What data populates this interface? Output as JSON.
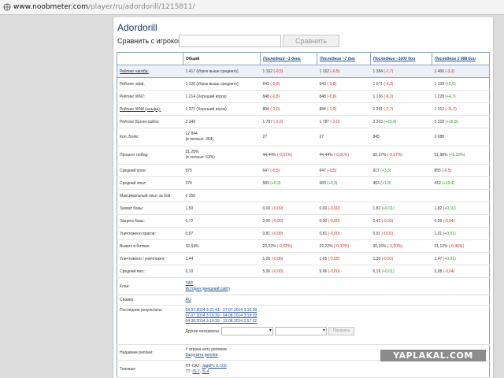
{
  "browser": {
    "url_domain": "www.noobmeter.com",
    "url_path": "/player/ru/adordorill/1215811/"
  },
  "player": {
    "name": "Adordorill"
  },
  "compare": {
    "label": "Сравнить с игроком",
    "input_value": "",
    "button": "Сравнить"
  },
  "table": {
    "columns": [
      "Общий",
      "Последний ~1 день",
      "Последние ~7 дни",
      "Последние ~1000 бои",
      "Последние 3 088 бои"
    ],
    "rows": [
      {
        "label": "Рейтинг нагиба:",
        "values": [
          "1 417 (Игрок выше среднего)",
          "1 162 (-0,5)",
          "1 162 (-0,5)",
          "1 384 (-2,7)",
          "1 406 (-3,2)"
        ]
      },
      {
        "label": "Рейтинг эфф.",
        "values": [
          "1 126 (Игрок выше среднего)",
          "643 (-0,8)",
          "643 (-0,8)",
          "1 071 (-4,3)",
          "1 139 (+5,0)"
        ]
      },
      {
        "label": "Рейтинг WN7:",
        "values": [
          "1 214 (Хороший игрок)",
          "848 (-0,8)",
          "848 (-0,8)",
          "1 136 (-8,2)",
          "1 228 (+4,7)"
        ]
      },
      {
        "label": "Рейтинг WN8 (альфа):",
        "values": [
          "1 372 (Хороший игрок)",
          "884 (-1,0)",
          "884 (-1,0)",
          "1 291 (-2,7)",
          "1 312 (-11,2)"
        ]
      },
      {
        "label": "Рейтинг Броне-сайта:",
        "values": [
          "3 249",
          "1 787 (-3,0)",
          "1 787 (-3,0)",
          "3 203 (+23,4)",
          "3 318 (+16,8)"
        ]
      },
      {
        "label": "Кол. Боёв:",
        "values": [
          "12 844",
          "27",
          "27",
          "845",
          "3 088"
        ],
        "subs": [
          "(в полных: 364)",
          "",
          "",
          "",
          ""
        ]
      },
      {
        "label": "Процент побед:",
        "values": [
          "51,28%",
          "44,44% (-0,01%)",
          "44,44% (-0,01%)",
          "50,37% (-0,07%)",
          "51,98% (+0,22%)"
        ],
        "subs": [
          "(в полных: 53%)",
          "",
          "",
          "",
          ""
        ]
      },
      {
        "label": "Средний урон:",
        "values": [
          "875",
          "647 (-0,5)",
          "647 (-0,5)",
          "917 (+3,3)",
          "855 (-6,5)"
        ]
      },
      {
        "label": "Средний опыт:",
        "values": [
          "379",
          "583 (+0,3)",
          "583 (+0,3)",
          "403 (+1,9)",
          "412 (+10,4)"
        ]
      },
      {
        "label": "Максимальный опыт за бой:",
        "values": [
          "2 256",
          "",
          "",
          "",
          ""
        ]
      },
      {
        "label": "Захват базы:",
        "values": [
          "1,50",
          "0,00 (-0,00)",
          "0,00 (-0,00)",
          "1,82 (+0,01)",
          "1,82 (+0,10)"
        ]
      },
      {
        "label": "Защита базы:",
        "values": [
          "0,72",
          "0,00 (-0,00)",
          "0,00 (-0,00)",
          "0,42 (-0,02)",
          "0,59 (-0,04)"
        ]
      },
      {
        "label": "Уничтожено врагов:",
        "values": [
          "0,97",
          "0,81 (-0,00)",
          "0,81 (-0,00)",
          "0,91 (-0,01)",
          "1,01 (+0,01)"
        ]
      },
      {
        "label": "Выжил в битвах:",
        "values": [
          "32,64%",
          "22,22% (-0,02%)",
          "22,22% (-0,02%)",
          "30,16% (-0,20%)",
          "31,12% (-0,46%)"
        ]
      },
      {
        "label": "Уничтожено / уничтожен:",
        "values": [
          "1,44",
          "1,05 (-0,00)",
          "1,05 (-0,00)",
          "1,30 (-0,01)",
          "1,47 (+0,01)"
        ]
      },
      {
        "label": "Средний пвл.:",
        "values": [
          "6,10",
          "5,96 (-0,00)",
          "5,96 (-0,00)",
          "6,19 (+0,01)",
          "5,98 (-0,04)"
        ]
      }
    ],
    "clan": {
      "label": "Клан:",
      "tag": "YAP",
      "history": "История (внешний сайт)"
    },
    "server": {
      "label": "Сервер:",
      "value": "RU"
    },
    "results": {
      "label": "Последние результаты:",
      "ranges": [
        "04.07.2014 3:21:41 - 07.07.2014 3:16:39",
        "07.07.2014 3:16:39 - 04.08.2014 3:19:39",
        "04.08.2014 3:19:39 - 12.08.2014 2:57:32"
      ],
      "other_label": "Другие интервалы:",
      "show_button": "Показать"
    },
    "replays": {
      "label": "Недавние реплеи:",
      "none_text": "У игрока нету реплеев",
      "upload_link": "Загрузить реплеи"
    },
    "tops": {
      "label": "Топовые",
      "line1_prefix": "ПТ-САУ:",
      "line1_link": "JagdPz E-100",
      "line2_prefix": "ТТ:",
      "line2_link1": "IS-7",
      "line2_link2": "IS-4"
    }
  },
  "watermark": {
    "text": "YAPLAKAL.COM"
  },
  "colors": {
    "positive": "#2d8a2d",
    "negative": "#c03030",
    "link": "#1f4a8a",
    "border": "#8aa4c8"
  }
}
